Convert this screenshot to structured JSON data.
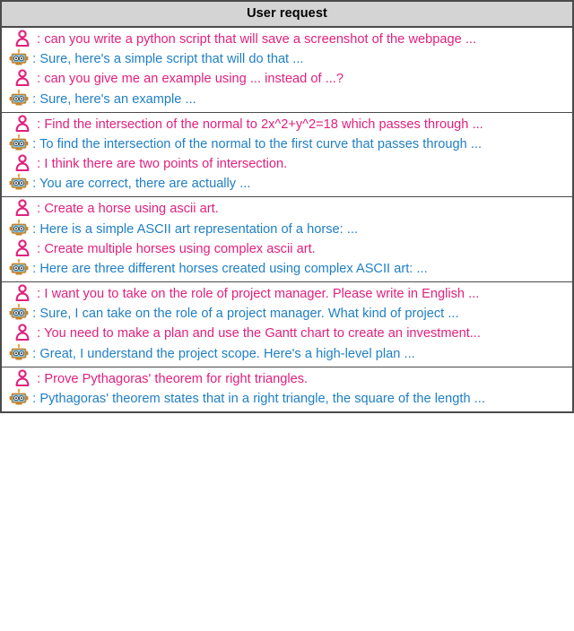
{
  "header": {
    "title": "User request"
  },
  "icons": {
    "user": "user-avatar-icon",
    "assistant": "robot-avatar-icon"
  },
  "colors": {
    "user_text": "#e0217e",
    "assistant_text": "#1f7fc4",
    "header_background": "#d4d4d4",
    "border": "#4a4a4a",
    "robot_head": "#7ec8e8",
    "robot_body": "#c8822a",
    "page_background": "#ffffff"
  },
  "sections": [
    {
      "id": "section-python-screenshot",
      "turns": [
        {
          "role": "user",
          "text": ": can you write a python script that will save a screenshot of the webpage ..."
        },
        {
          "role": "assistant",
          "text": ": Sure, here's a simple script that will do that ..."
        },
        {
          "role": "user",
          "text": ": can you give me an example using ... instead of ...?"
        },
        {
          "role": "assistant",
          "text": ": Sure, here's an example ..."
        }
      ]
    },
    {
      "id": "section-normal-intersection",
      "turns": [
        {
          "role": "user",
          "text": ": Find the intersection of the normal to 2x^2+y^2=18 which passes through ..."
        },
        {
          "role": "assistant",
          "text": ": To find the intersection of the normal to the first curve that passes through ..."
        },
        {
          "role": "user",
          "text": ": I think there are two points of intersection."
        },
        {
          "role": "assistant",
          "text": ": You are correct, there are actually ..."
        }
      ]
    },
    {
      "id": "section-ascii-horse",
      "turns": [
        {
          "role": "user",
          "text": ": Create a horse using ascii art."
        },
        {
          "role": "assistant",
          "text": ": Here is a simple ASCII art representation of a horse: ..."
        },
        {
          "role": "user",
          "text": ": Create multiple horses using complex ascii art."
        },
        {
          "role": "assistant",
          "text": ": Here are three different horses created using complex ASCII art: ..."
        }
      ]
    },
    {
      "id": "section-project-manager",
      "turns": [
        {
          "role": "user",
          "text": ": I want you to take on the role of project manager.  Please write in English ..."
        },
        {
          "role": "assistant",
          "text": ": Sure, I can take on the role of a project manager. What kind of project ..."
        },
        {
          "role": "user",
          "text": ": You need to make a plan and use the Gantt chart to create an investment..."
        },
        {
          "role": "assistant",
          "text": ": Great, I understand the project scope. Here's a high-level plan ..."
        }
      ]
    },
    {
      "id": "section-pythagoras",
      "turns": [
        {
          "role": "user",
          "text": ": Prove Pythagoras' theorem for right triangles."
        },
        {
          "role": "assistant",
          "text": ": Pythagoras' theorem states that in a right triangle, the square of the length ..."
        }
      ]
    }
  ]
}
